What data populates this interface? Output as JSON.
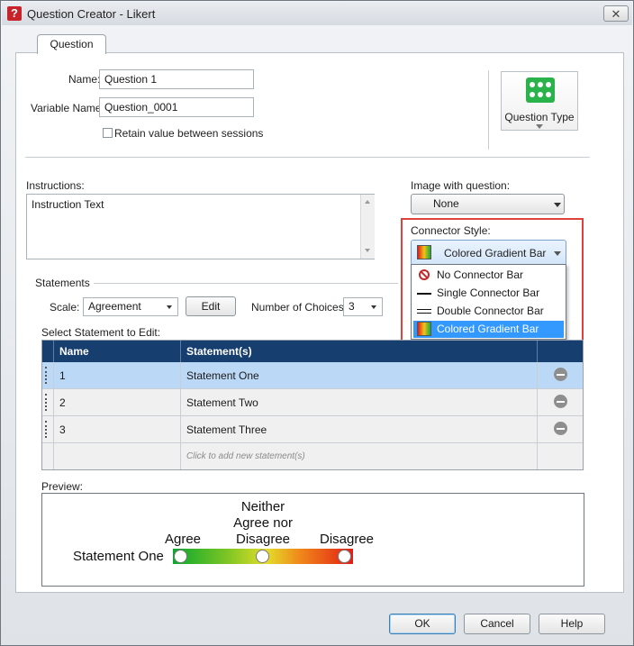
{
  "window": {
    "title": "Question Creator - Likert",
    "app_icon_glyph": "?",
    "close_glyph": "✕"
  },
  "tabs": [
    {
      "label": "Question"
    }
  ],
  "form": {
    "name_label": "Name:",
    "name_value": "Question 1",
    "variable_label": "Variable Name:",
    "variable_value": "Question_0001",
    "retain_label": "Retain value between sessions",
    "retain_checked": false
  },
  "question_type": {
    "label": "Question Type",
    "icon": "dots-grid-icon"
  },
  "instructions": {
    "label": "Instructions:",
    "value": "Instruction Text"
  },
  "image_with_question": {
    "label": "Image with question:",
    "value": "None"
  },
  "connector_style": {
    "label": "Connector Style:",
    "value": "Colored Gradient Bar",
    "options": [
      {
        "label": "No Connector Bar",
        "icon": "no-symbol-icon"
      },
      {
        "label": "Single Connector Bar",
        "icon": "single-line-icon"
      },
      {
        "label": "Double Connector Bar",
        "icon": "double-line-icon"
      },
      {
        "label": "Colored Gradient Bar",
        "icon": "gradient-bar-icon"
      }
    ],
    "selected_index": 3
  },
  "statements": {
    "section_label": "Statements",
    "scale_label": "Scale:",
    "scale_value": "Agreement",
    "edit_label": "Edit",
    "choices_label": "Number of Choices:",
    "choices_value": "3",
    "select_label": "Select Statement to Edit:",
    "columns": [
      "Name",
      "Statement(s)"
    ],
    "rows": [
      {
        "name": "1",
        "statement": "Statement One",
        "selected": true
      },
      {
        "name": "2",
        "statement": "Statement Two",
        "selected": false
      },
      {
        "name": "3",
        "statement": "Statement Three",
        "selected": false
      }
    ],
    "add_placeholder": "Click to add new statement(s)"
  },
  "preview": {
    "label": "Preview:",
    "statement": "Statement One",
    "choices": [
      "Agree",
      "Neither Agree nor Disagree",
      "Disagree"
    ],
    "choice_lines": {
      "agree": [
        "Agree"
      ],
      "neither": [
        "Neither",
        "Agree nor",
        "Disagree"
      ],
      "disagree": [
        "Disagree"
      ]
    }
  },
  "buttons": {
    "ok": "OK",
    "cancel": "Cancel",
    "help": "Help"
  },
  "colors": {
    "header": "#163e6e",
    "selection": "#3399ff",
    "highlight_box": "#e0413b",
    "qtype_green": "#29b34a"
  }
}
